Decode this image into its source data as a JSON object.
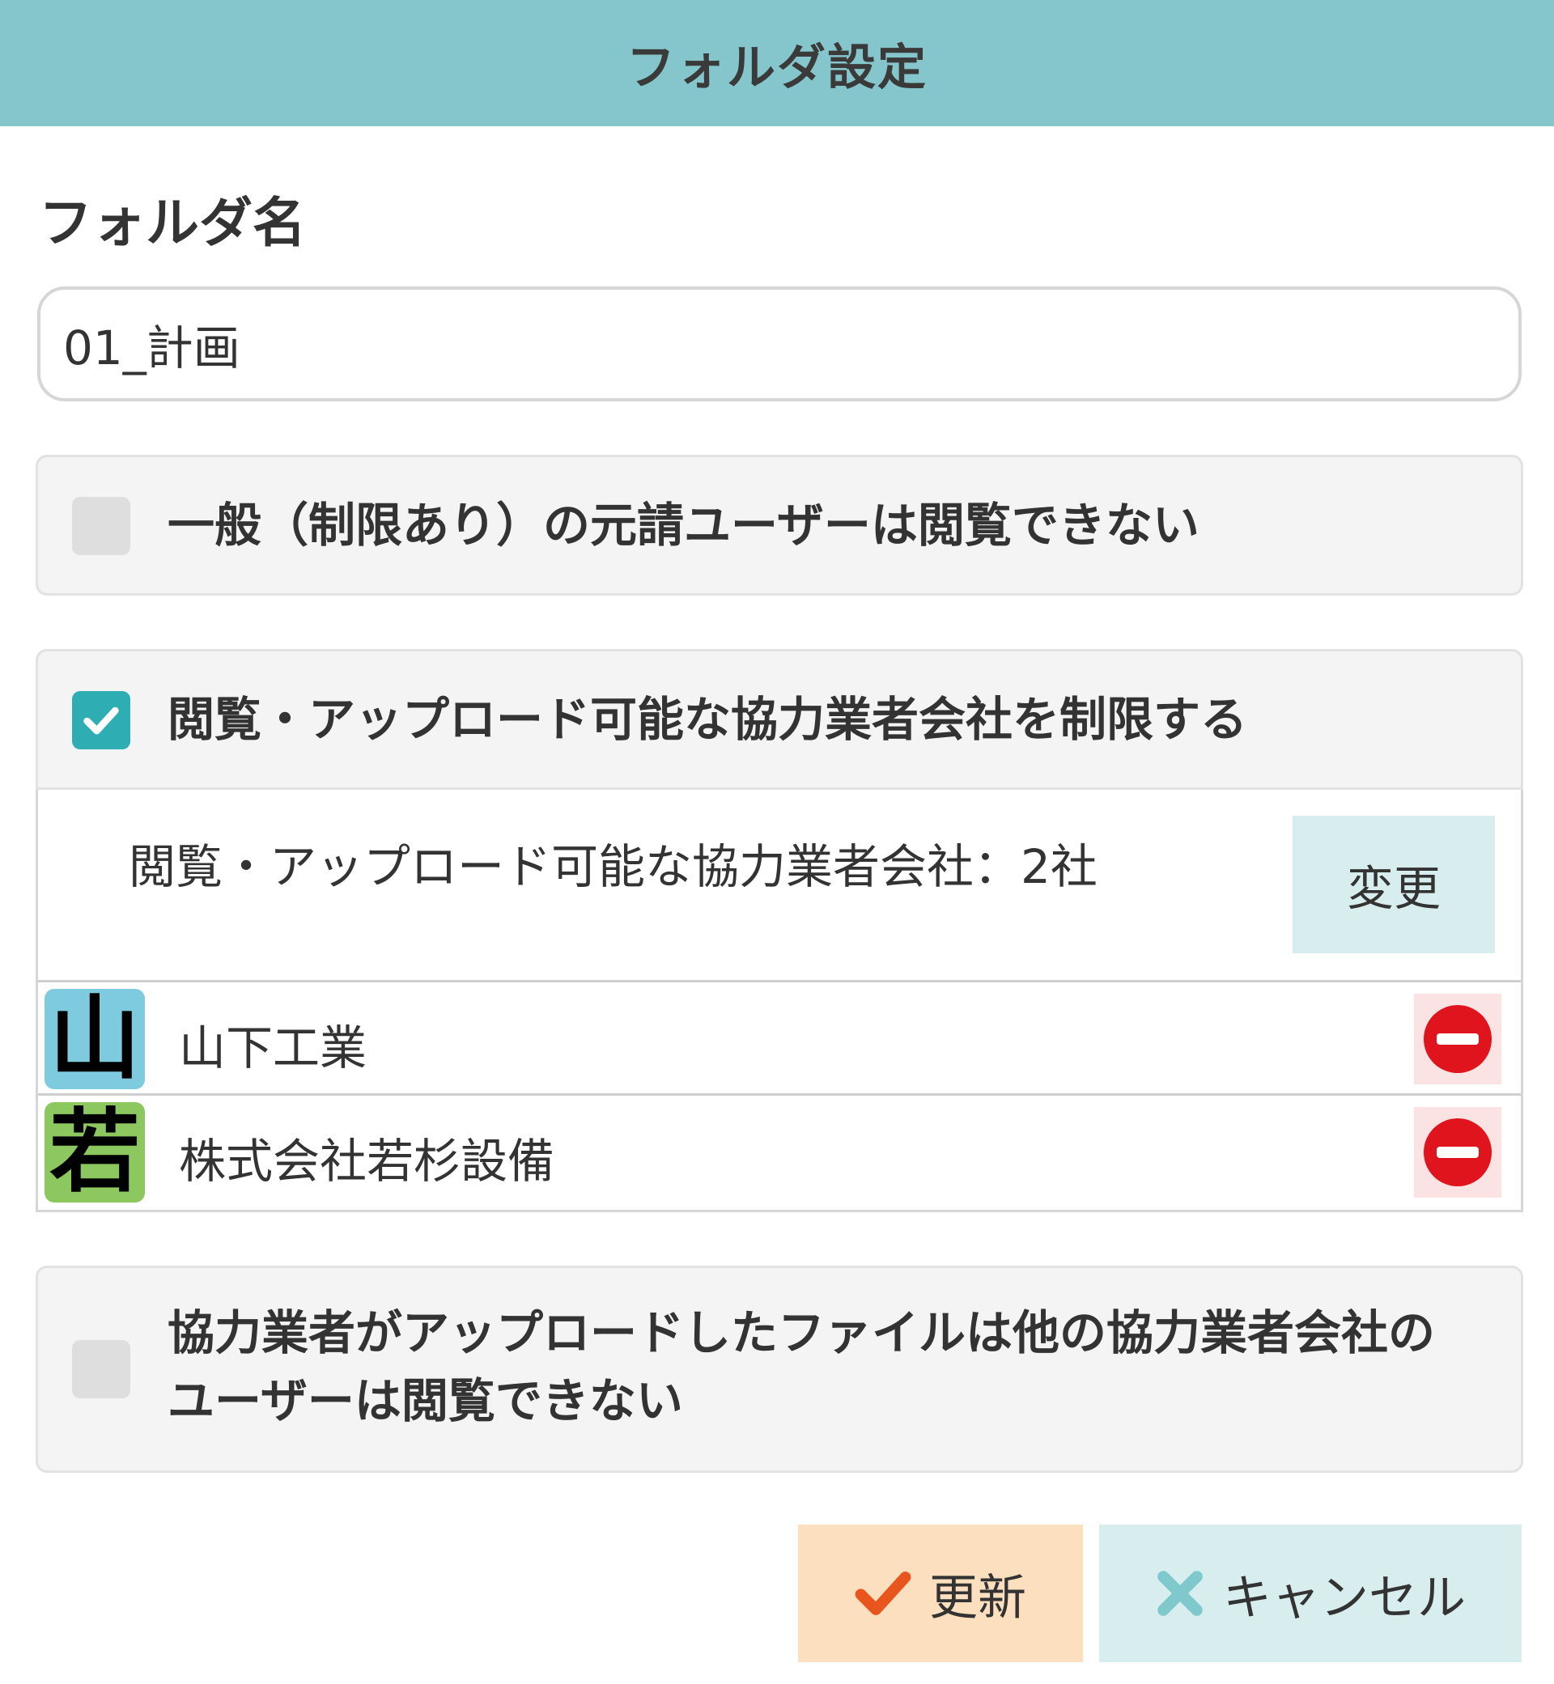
{
  "header": {
    "title": "フォルダ設定"
  },
  "folder_name": {
    "label": "フォルダ名",
    "value": "01_計画"
  },
  "options": [
    {
      "label": "一般（制限あり）の元請ユーザーは閲覧できない",
      "checked": false
    },
    {
      "label": "閲覧・アップロード可能な協力業者会社を制限する",
      "checked": true
    },
    {
      "label": "協力業者がアップロードしたファイルは他の協力業者会社のユーザーは閲覧できない",
      "checked": false
    }
  ],
  "companies_panel": {
    "count_label": "閲覧・アップロード可能な協力業者会社：2社",
    "change_label": "変更",
    "companies": [
      {
        "avatar_char": "山",
        "avatar_color": "#7ecbe0",
        "name": "山下工業"
      },
      {
        "avatar_char": "若",
        "avatar_color": "#8cc760",
        "name": "株式会社若杉設備"
      }
    ]
  },
  "footer": {
    "update_label": "更新",
    "cancel_label": "キャンセル"
  },
  "colors": {
    "header_bg": "#84c6cb",
    "checkbox_checked": "#2eaeb2",
    "remove_icon": "#e0141c",
    "update_icon": "#e8561e",
    "cancel_icon": "#7fc9cc"
  }
}
